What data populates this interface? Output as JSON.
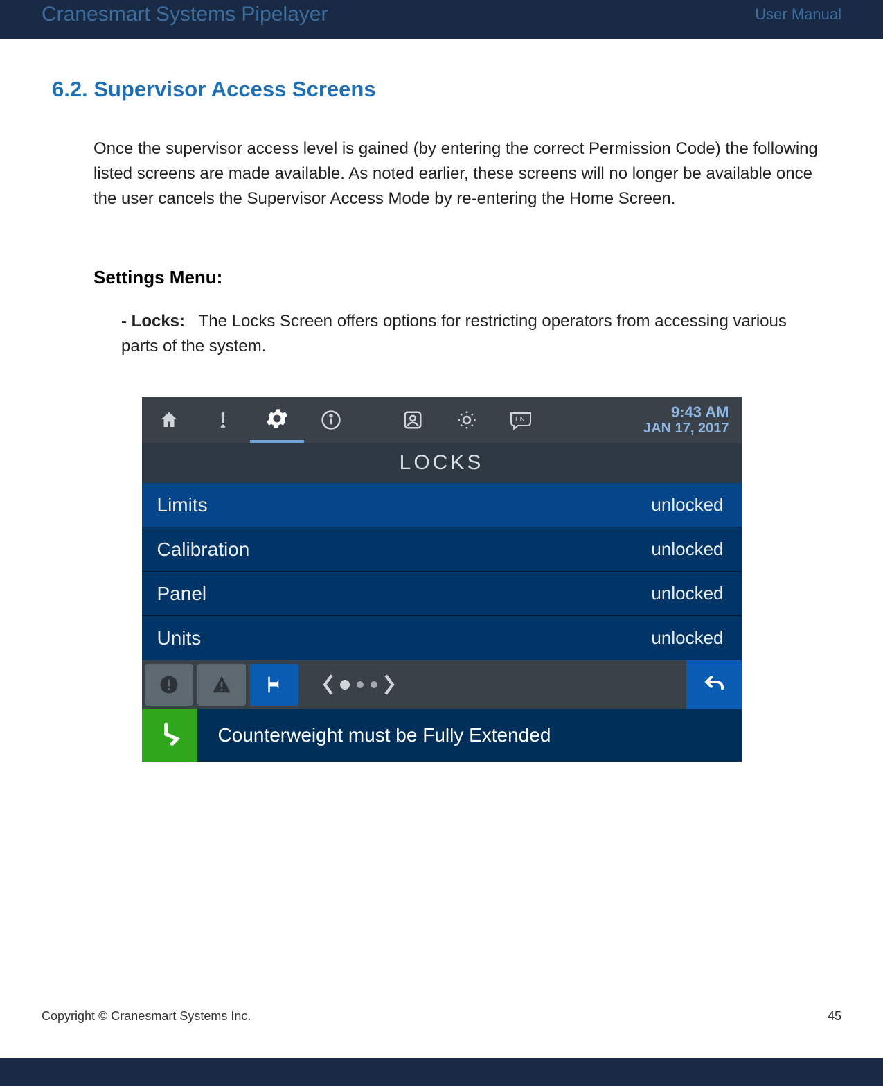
{
  "header": {
    "product": "Cranesmart Systems Pipelayer",
    "doc_type": "User Manual"
  },
  "section": {
    "number_title": "6.2. Supervisor Access Screens",
    "intro": "Once the supervisor access level is gained (by entering the correct Permission Code) the following listed screens are made available.  As noted earlier, these screens will no longer be available once the user cancels the Supervisor Access Mode by re-entering the Home Screen."
  },
  "settings": {
    "heading": "Settings Menu:",
    "locks_label": "- Locks:",
    "locks_desc": "The Locks Screen offers options for restricting operators from accessing various parts of the system."
  },
  "device": {
    "time": "9:43 AM",
    "date": "JAN 17, 2017",
    "title": "LOCKS",
    "rows": [
      {
        "label": "Limits",
        "value": "unlocked",
        "active": true
      },
      {
        "label": "Calibration",
        "value": "unlocked",
        "active": false
      },
      {
        "label": "Panel",
        "value": "unlocked",
        "active": false
      },
      {
        "label": "Units",
        "value": "unlocked",
        "active": false
      }
    ],
    "alert": "Counterweight must be Fully Extended"
  },
  "footer": {
    "copyright": "Copyright © Cranesmart Systems Inc.",
    "page": "45"
  }
}
